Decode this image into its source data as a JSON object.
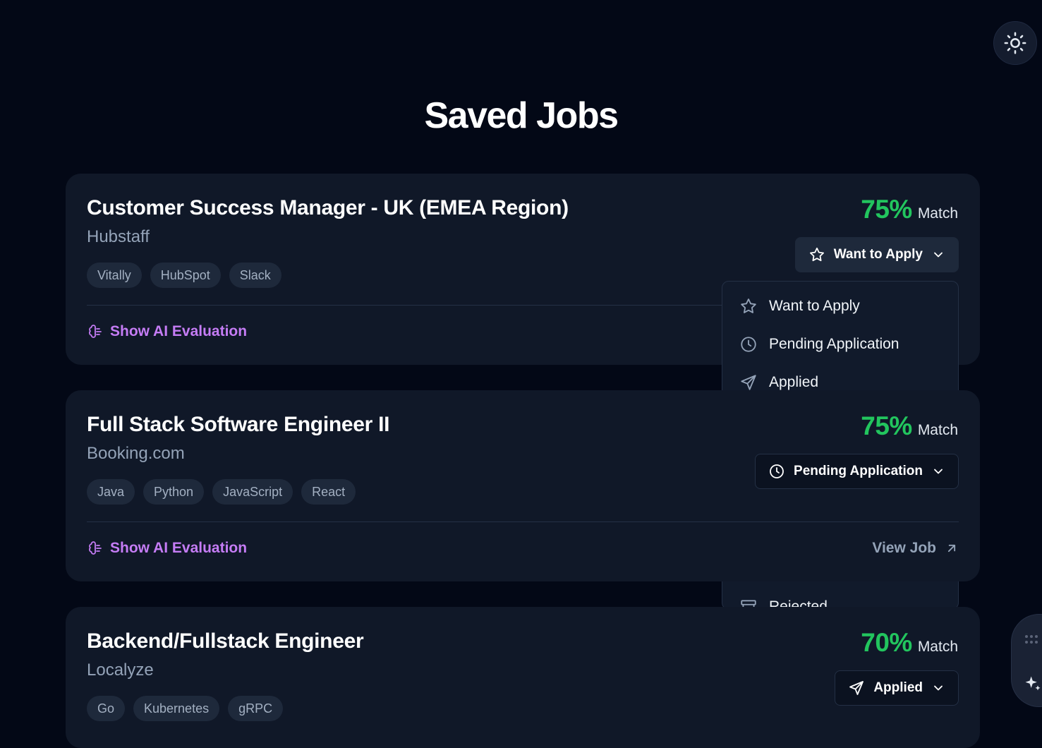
{
  "page": {
    "title": "Saved Jobs"
  },
  "jobs": [
    {
      "title": "Customer Success Manager - UK (EMEA Region)",
      "company": "Hubstaff",
      "tags": [
        "Vitally",
        "HubSpot",
        "Slack"
      ],
      "match_percent": "75%",
      "match_label": "Match",
      "status": "Want to Apply",
      "ai_eval_label": "Show AI Evaluation"
    },
    {
      "title": "Full Stack Software Engineer II",
      "company": "Booking.com",
      "tags": [
        "Java",
        "Python",
        "JavaScript",
        "React"
      ],
      "match_percent": "75%",
      "match_label": "Match",
      "status": "Pending Application",
      "ai_eval_label": "Show AI Evaluation",
      "view_job_label": "View Job"
    },
    {
      "title": "Backend/Fullstack Engineer",
      "company": "Localyze",
      "tags": [
        "Go",
        "Kubernetes",
        "gRPC"
      ],
      "match_percent": "70%",
      "match_label": "Match",
      "status": "Applied"
    }
  ],
  "status_menu": {
    "items": [
      {
        "label": "Want to Apply",
        "icon": "star-icon"
      },
      {
        "label": "Pending Application",
        "icon": "clock-icon"
      },
      {
        "label": "Applied",
        "icon": "send-icon"
      },
      {
        "label": "Rejected",
        "icon": "archive-icon"
      }
    ]
  },
  "colors": {
    "background": "#030816",
    "card": "#101828",
    "match_green": "#22c55e",
    "ai_purple": "#c57cf5"
  },
  "icons": {
    "theme_toggle": "sun-icon",
    "ai_evaluation": "brain-icon",
    "view_job": "arrow-up-right-icon",
    "dropdown": "chevron-down-icon"
  }
}
